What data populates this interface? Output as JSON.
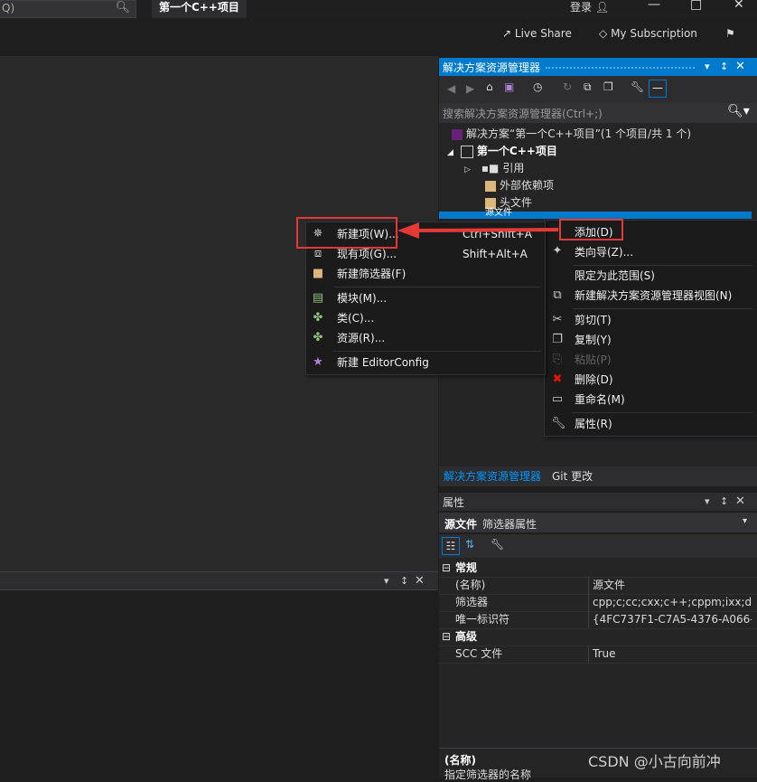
{
  "titlebar": {
    "search_hint": "Q)",
    "project_title": "第一个C++项目",
    "login": "登录"
  },
  "toolbar": {
    "live_share": "Live Share",
    "subscription": "My Subscription"
  },
  "solution_explorer": {
    "title": "解决方案资源管理器",
    "search_placeholder": "搜索解决方案资源管理器(Ctrl+;)",
    "tree": {
      "solution": "解决方案“第一个C++项目”(1 个项目/共 1 个)",
      "project": "第一个C++项目",
      "references": "引用",
      "external_deps": "外部依赖项",
      "headers": "头文件",
      "sources": "源文件"
    },
    "tabs": {
      "active": "解决方案资源管理器",
      "git": "Git 更改"
    }
  },
  "context_menu": {
    "items": [
      {
        "label": "添加(D)"
      },
      {
        "label": "类向导(Z)..."
      },
      {
        "label": "限定为此范围(S)"
      },
      {
        "label": "新建解决方案资源管理器视图(N)"
      },
      {
        "label": "剪切(T)"
      },
      {
        "label": "复制(Y)"
      },
      {
        "label": "粘贴(P)"
      },
      {
        "label": "删除(D)"
      },
      {
        "label": "重命名(M)"
      },
      {
        "label": "属性(R)"
      }
    ]
  },
  "add_submenu": {
    "items": [
      {
        "label": "新建项(W)...",
        "shortcut": "Ctrl+Shift+A"
      },
      {
        "label": "现有项(G)...",
        "shortcut": "Shift+Alt+A"
      },
      {
        "label": "新建筛选器(F)",
        "shortcut": ""
      },
      {
        "label": "模块(M)...",
        "shortcut": ""
      },
      {
        "label": "类(C)...",
        "shortcut": ""
      },
      {
        "label": "资源(R)...",
        "shortcut": ""
      },
      {
        "label": "新建 EditorConfig",
        "shortcut": ""
      }
    ]
  },
  "properties": {
    "title": "属性",
    "object_name": "源文件",
    "object_type": "筛选器属性",
    "categories": {
      "general": "常规",
      "advanced": "高级"
    },
    "rows": [
      {
        "name": "(名称)",
        "value": "源文件"
      },
      {
        "name": "筛选器",
        "value": "cpp;c;cc;cxx;c++;cppm;ixx;def;"
      },
      {
        "name": "唯一标识符",
        "value": "{4FC737F1-C7A5-4376-A066-2"
      },
      {
        "name": "SCC 文件",
        "value": "True"
      }
    ],
    "desc_title": "(名称)",
    "desc_text": "指定筛选器的名称"
  },
  "watermark": "CSDN @小古向前冲",
  "colors": {
    "accent": "#007acc",
    "highlight": "#e53935"
  }
}
